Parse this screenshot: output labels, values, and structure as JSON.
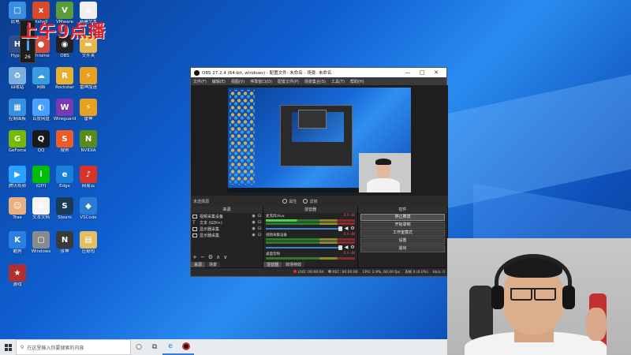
{
  "desktop": {
    "watermark": "上午9点播",
    "volume_level": "26",
    "icons": [
      {
        "label": "此电脑",
        "glyph": "□",
        "color": "#3b8de0"
      },
      {
        "label": "Xshell",
        "glyph": "x",
        "color": "#d94a2a"
      },
      {
        "label": "VMware",
        "glyph": "V",
        "color": "#5b9c3a"
      },
      {
        "label": "新建文本",
        "glyph": "≡",
        "color": "#f0f0f0"
      },
      {
        "label": "Hyper",
        "glyph": "H",
        "color": "#2d4f8a"
      },
      {
        "label": "Chrome",
        "glyph": "●",
        "color": "#d64a3a"
      },
      {
        "label": "OBS",
        "glyph": "◉",
        "color": "#222222"
      },
      {
        "label": "文件夹",
        "glyph": "▬",
        "color": "#e8b84a"
      },
      {
        "label": "回收站",
        "glyph": "♻",
        "color": "#7ab0e0"
      },
      {
        "label": "网络",
        "glyph": "☁",
        "color": "#3a9ce0"
      },
      {
        "label": "Rockstar",
        "glyph": "R",
        "color": "#e8b030"
      },
      {
        "label": "雷神加速",
        "glyph": "⚡",
        "color": "#e8a020"
      },
      {
        "label": "控制面板",
        "glyph": "▦",
        "color": "#3a90e0"
      },
      {
        "label": "百度网盘",
        "glyph": "◐",
        "color": "#4aa0ff"
      },
      {
        "label": "Wireguard",
        "glyph": "W",
        "color": "#7a3ab0"
      },
      {
        "label": "雷神",
        "glyph": "⚡",
        "color": "#e8a020"
      },
      {
        "label": "GeForce",
        "glyph": "G",
        "color": "#76b900"
      },
      {
        "label": "QQ",
        "glyph": "Q",
        "color": "#1a1a1a"
      },
      {
        "label": "搜狗",
        "glyph": "S",
        "color": "#f05a28"
      },
      {
        "label": "NVIDIA",
        "glyph": "N",
        "color": "#5a8a1a"
      },
      {
        "label": "腾讯视频",
        "glyph": "▶",
        "color": "#2aa0ff"
      },
      {
        "label": "iQIYI",
        "glyph": "i",
        "color": "#00be06"
      },
      {
        "label": "Edge",
        "glyph": "e",
        "color": "#1a7fd6"
      },
      {
        "label": "网易云",
        "glyph": "♪",
        "color": "#d6332a"
      },
      {
        "label": "Trae",
        "glyph": "☺",
        "color": "#e8b080"
      },
      {
        "label": "文本文档",
        "glyph": "≡",
        "color": "#f4f4f4"
      },
      {
        "label": "Steam",
        "glyph": "S",
        "color": "#1a3a5a"
      },
      {
        "label": "VSCode",
        "glyph": "◆",
        "color": "#2a7ad6"
      },
      {
        "label": "酷狗",
        "glyph": "K",
        "color": "#2a80e0"
      },
      {
        "label": "Windows",
        "glyph": "▢",
        "color": "#8a8a8a"
      },
      {
        "label": "夜神",
        "glyph": "N",
        "color": "#3a3a3a"
      },
      {
        "label": "压缩包",
        "glyph": "▤",
        "color": "#e0c060"
      },
      {
        "label": "游戏",
        "glyph": "★",
        "color": "#b03030"
      }
    ]
  },
  "obs": {
    "title": "OBS 27.2.4 (64-bit, windows) - 配置文件: 未命名 - 场景: 未命名",
    "window_controls": [
      "—",
      "□",
      "✕"
    ],
    "menu": [
      "文件(F)",
      "编辑(E)",
      "视图(V)",
      "停靠窗口(D)",
      "配置文件(P)",
      "场景集合(S)",
      "工具(T)",
      "帮助(H)"
    ],
    "context_bar": {
      "scene_label": "未选择源",
      "props": "属性",
      "filters": "滤镜"
    },
    "sources": {
      "header": "来源",
      "items": [
        "视频采集设备",
        "文本 (GDI+)",
        "显示器采集",
        "显示器采集"
      ]
    },
    "mixer": {
      "header": "混音器",
      "channels": [
        {
          "name": "麦克风/Aux",
          "db": "0.0 dB"
        },
        {
          "name": "视频采集设备",
          "db": "0.0 dB"
        },
        {
          "name": "桌面音频",
          "db": "0.0 dB"
        }
      ]
    },
    "controls": {
      "header": "控件",
      "buttons": [
        "停止推流",
        "开始录制",
        "工作室模式",
        "设置",
        "退出"
      ]
    },
    "tabs_left": [
      "来源",
      "场景"
    ],
    "tabs_mid": [
      "混音器",
      "转场特效"
    ],
    "status": {
      "live": "LIVE: 00:00:04",
      "rec": "REC: 00:00:00",
      "cpu": "CPU: 2.9%, 60.00 fps",
      "dropped": "丢帧 0 (0.0%)",
      "kbps": "kb/s: 0"
    }
  },
  "taskbar": {
    "search_placeholder": "在这里输入你要搜索的内容"
  },
  "colors": {
    "desktop_blue": "#0f5fd1",
    "obs_dark": "#2b2b2b",
    "watermark_red": "#e0202a"
  }
}
